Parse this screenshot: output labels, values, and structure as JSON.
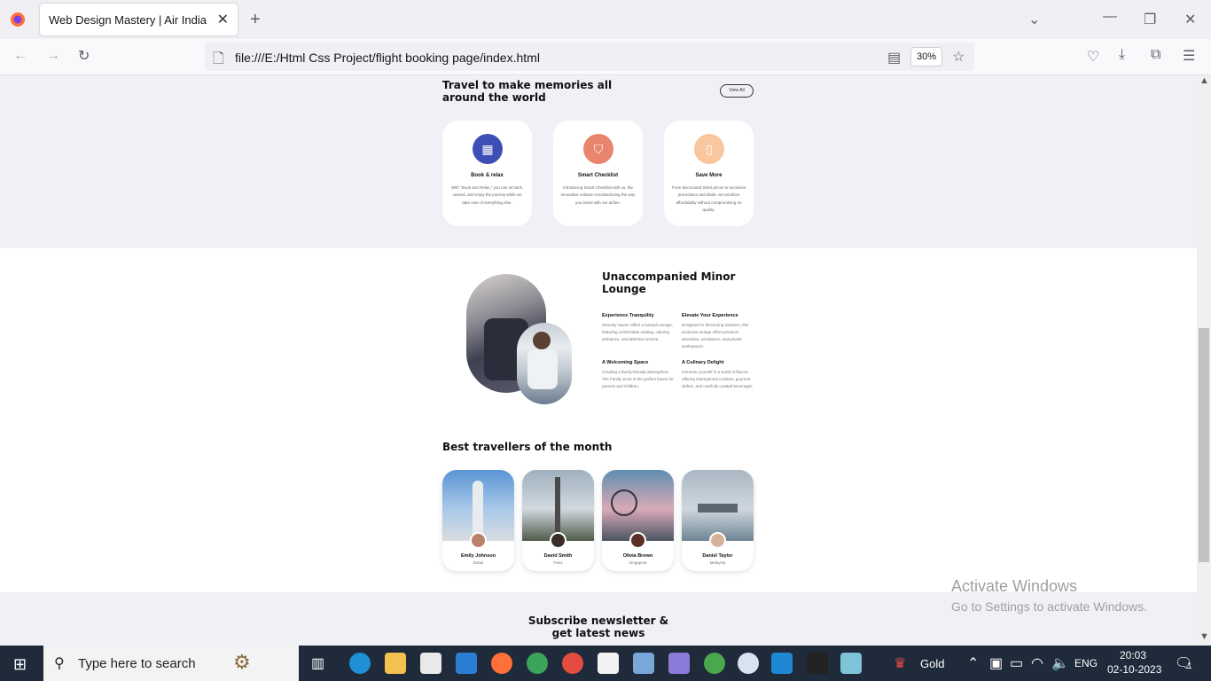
{
  "browser": {
    "tab_title": "Web Design Mastery | Air India",
    "url": "file:///E:/Html Css Project/flight booking page/index.html",
    "zoom": "30%"
  },
  "section_features": {
    "title_line1": "Travel to make memories all",
    "title_line2": "around the world",
    "view_all": "View All",
    "cards": [
      {
        "title": "Book & relax",
        "desc": "With \"Book and Relax,\" you can sit back, unwind, and enjoy the journey while we take care of everything else.",
        "icon": "calendar-icon",
        "color": "#3d4fb6"
      },
      {
        "title": "Smart Checklist",
        "desc": "Introducing Smart Checklist with us, the innovative solution revolutionizing the way you travel with our airline.",
        "icon": "shield-check-icon",
        "color": "#e8856c"
      },
      {
        "title": "Save More",
        "desc": "From discounted ticket prices to exclusive promotions and deals, we prioritize affordability without compromising on quality.",
        "icon": "bookmark-icon",
        "color": "#f9c69d"
      }
    ]
  },
  "section_lounge": {
    "title_line1": "Unaccompanied Minor",
    "title_line2": "Lounge",
    "features": [
      {
        "title": "Experience Tranquility",
        "desc": "Serenity Haven offers a tranquil escape, featuring comfortable seating, calming ambiance, and attentive service."
      },
      {
        "title": "Elevate Your Experience",
        "desc": "Designed for discerning travelers, this exclusive lounge offers premium amenities, assistance, and private workspaces."
      },
      {
        "title": "A Welcoming Space",
        "desc": "Creating a family-friendly atmosphere, The Family Zone is the perfect haven for parents and children."
      },
      {
        "title": "A Culinary Delight",
        "desc": "Immerse yourself in a world of flavors, offering international cuisines, gourmet dishes, and carefully curated beverages."
      }
    ]
  },
  "section_travellers": {
    "title": "Best travellers of the month",
    "items": [
      {
        "name": "Emily Johnson",
        "place": "Dubai"
      },
      {
        "name": "David Smith",
        "place": "Paris"
      },
      {
        "name": "Olivia Brown",
        "place": "Singapore"
      },
      {
        "name": "Daniel Taylor",
        "place": "Malaysia"
      }
    ]
  },
  "section_newsletter": {
    "title_line1": "Subscribe newsletter &",
    "title_line2": "get latest news"
  },
  "watermark": {
    "line1": "Activate Windows",
    "line2": "Go to Settings to activate Windows."
  },
  "taskbar": {
    "search_placeholder": "Type here to search",
    "stock_label": "Gold",
    "language": "ENG",
    "time": "20:03",
    "date": "02-10-2023",
    "notification_count": "1"
  }
}
